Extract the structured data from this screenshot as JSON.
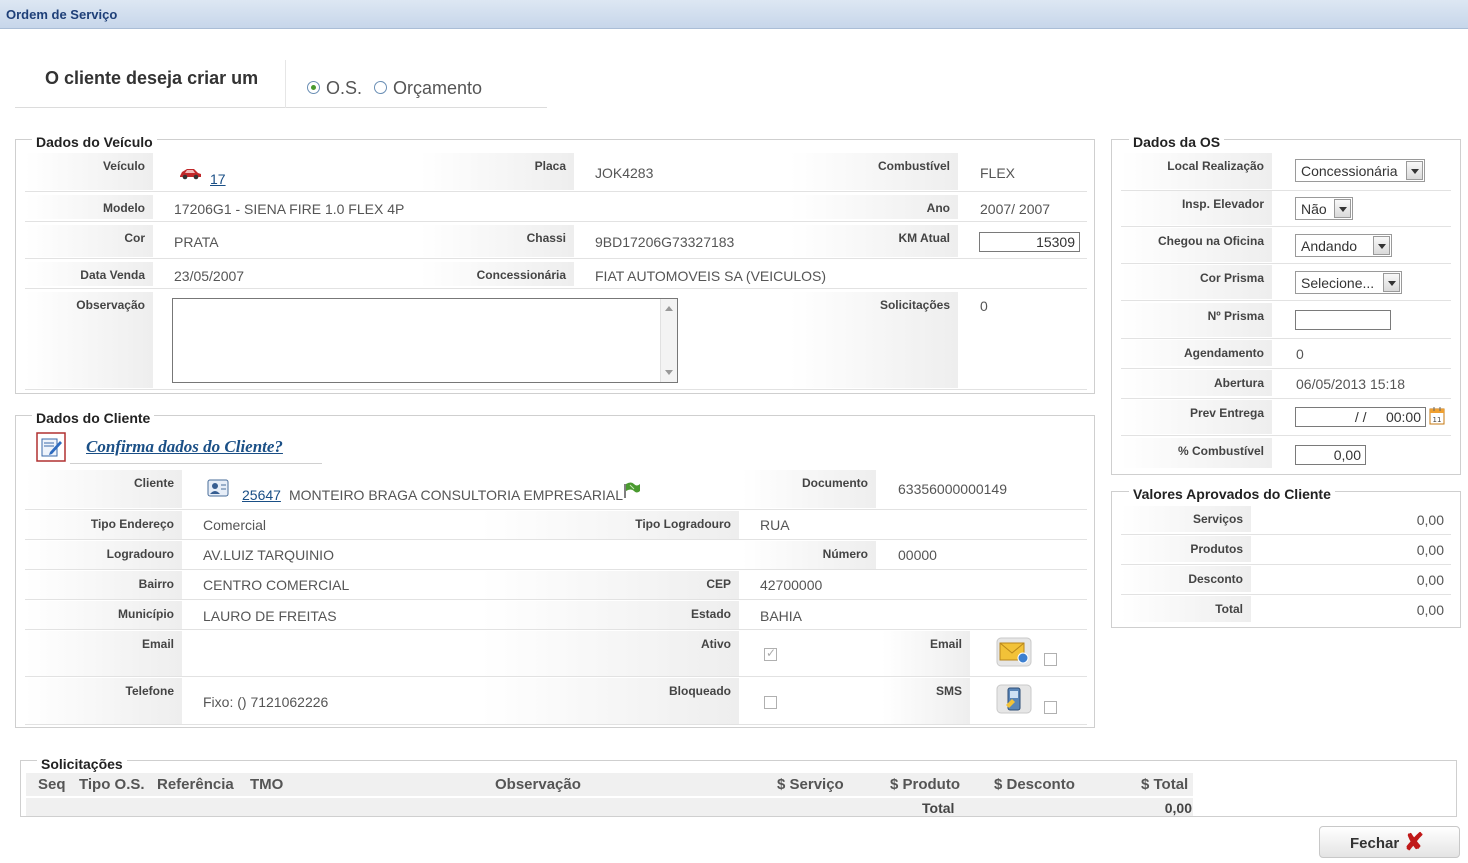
{
  "title": "Ordem de Serviço",
  "choice": {
    "question": "O cliente deseja criar um",
    "options": [
      "O.S.",
      "Orçamento"
    ],
    "selected": "O.S."
  },
  "veiculo": {
    "legend": "Dados do Veículo",
    "labels": {
      "veiculo": "Veículo",
      "placa": "Placa",
      "combustivel": "Combustível",
      "modelo": "Modelo",
      "ano": "Ano",
      "cor": "Cor",
      "chassi": "Chassi",
      "km": "KM Atual",
      "data_venda": "Data Venda",
      "concessionaria": "Concessionária",
      "observacao": "Observação",
      "solicitacoes": "Solicitações"
    },
    "values": {
      "veiculo": "17",
      "placa": "JOK4283",
      "combustivel": "FLEX",
      "modelo": "17206G1 - SIENA FIRE 1.0 FLEX 4P",
      "ano": "2007/ 2007",
      "cor": "PRATA",
      "chassi": "9BD17206G73327183",
      "km": "15309",
      "data_venda": "23/05/2007",
      "concessionaria": "FIAT AUTOMOVEIS SA (VEICULOS)",
      "observacao": "",
      "solicitacoes": "0"
    }
  },
  "os": {
    "legend": "Dados da OS",
    "labels": {
      "local": "Local Realização",
      "elevador": "Insp. Elevador",
      "chegou": "Chegou na Oficina",
      "cor_prisma": "Cor Prisma",
      "n_prisma": "Nº Prisma",
      "agendamento": "Agendamento",
      "abertura": "Abertura",
      "prev_entrega": "Prev Entrega",
      "combustivel": "% Combustível"
    },
    "values": {
      "local": "Concessionária",
      "elevador": "Não",
      "chegou": "Andando",
      "cor_prisma": "Selecione...",
      "n_prisma": "",
      "agendamento": "0",
      "abertura": "06/05/2013 15:18",
      "prev_entrega": "/ /     00:00",
      "combustivel": "0,00"
    }
  },
  "valores": {
    "legend": "Valores Aprovados do Cliente",
    "labels": {
      "servicos": "Serviços",
      "produtos": "Produtos",
      "desconto": "Desconto",
      "total": "Total"
    },
    "values": {
      "servicos": "0,00",
      "produtos": "0,00",
      "desconto": "0,00",
      "total": "0,00"
    }
  },
  "cliente": {
    "legend": "Dados do Cliente",
    "confirm_link": "Confirma dados do Cliente?",
    "labels": {
      "cliente": "Cliente",
      "documento": "Documento",
      "tipo_endereco": "Tipo Endereço",
      "tipo_logradouro": "Tipo Logradouro",
      "logradouro": "Logradouro",
      "numero": "Número",
      "bairro": "Bairro",
      "cep": "CEP",
      "municipio": "Município",
      "estado": "Estado",
      "email": "Email",
      "ativo": "Ativo",
      "email2": "Email",
      "telefone": "Telefone",
      "bloqueado": "Bloqueado",
      "sms": "SMS"
    },
    "values": {
      "cliente_code": "25647",
      "cliente_name": "MONTEIRO BRAGA CONSULTORIA EMPRESARIAL",
      "documento": "63356000000149",
      "tipo_endereco": "Comercial",
      "tipo_logradouro": "RUA",
      "logradouro": "AV.LUIZ TARQUINIO",
      "numero": "00000",
      "bairro": "CENTRO COMERCIAL",
      "cep": "42700000",
      "municipio": "LAURO DE FREITAS",
      "estado": "BAHIA",
      "email": "",
      "telefone": "Fixo: () 7121062226"
    }
  },
  "solicitacoes": {
    "legend": "Solicitações",
    "columns": [
      "Seq",
      "Tipo O.S.",
      "Referência",
      "TMO",
      "Observação",
      "$ Serviço",
      "$ Produto",
      "$ Desconto",
      "$ Total"
    ],
    "total_label": "Total",
    "total_value": "0,00"
  },
  "buttons": {
    "close": "Fechar"
  }
}
